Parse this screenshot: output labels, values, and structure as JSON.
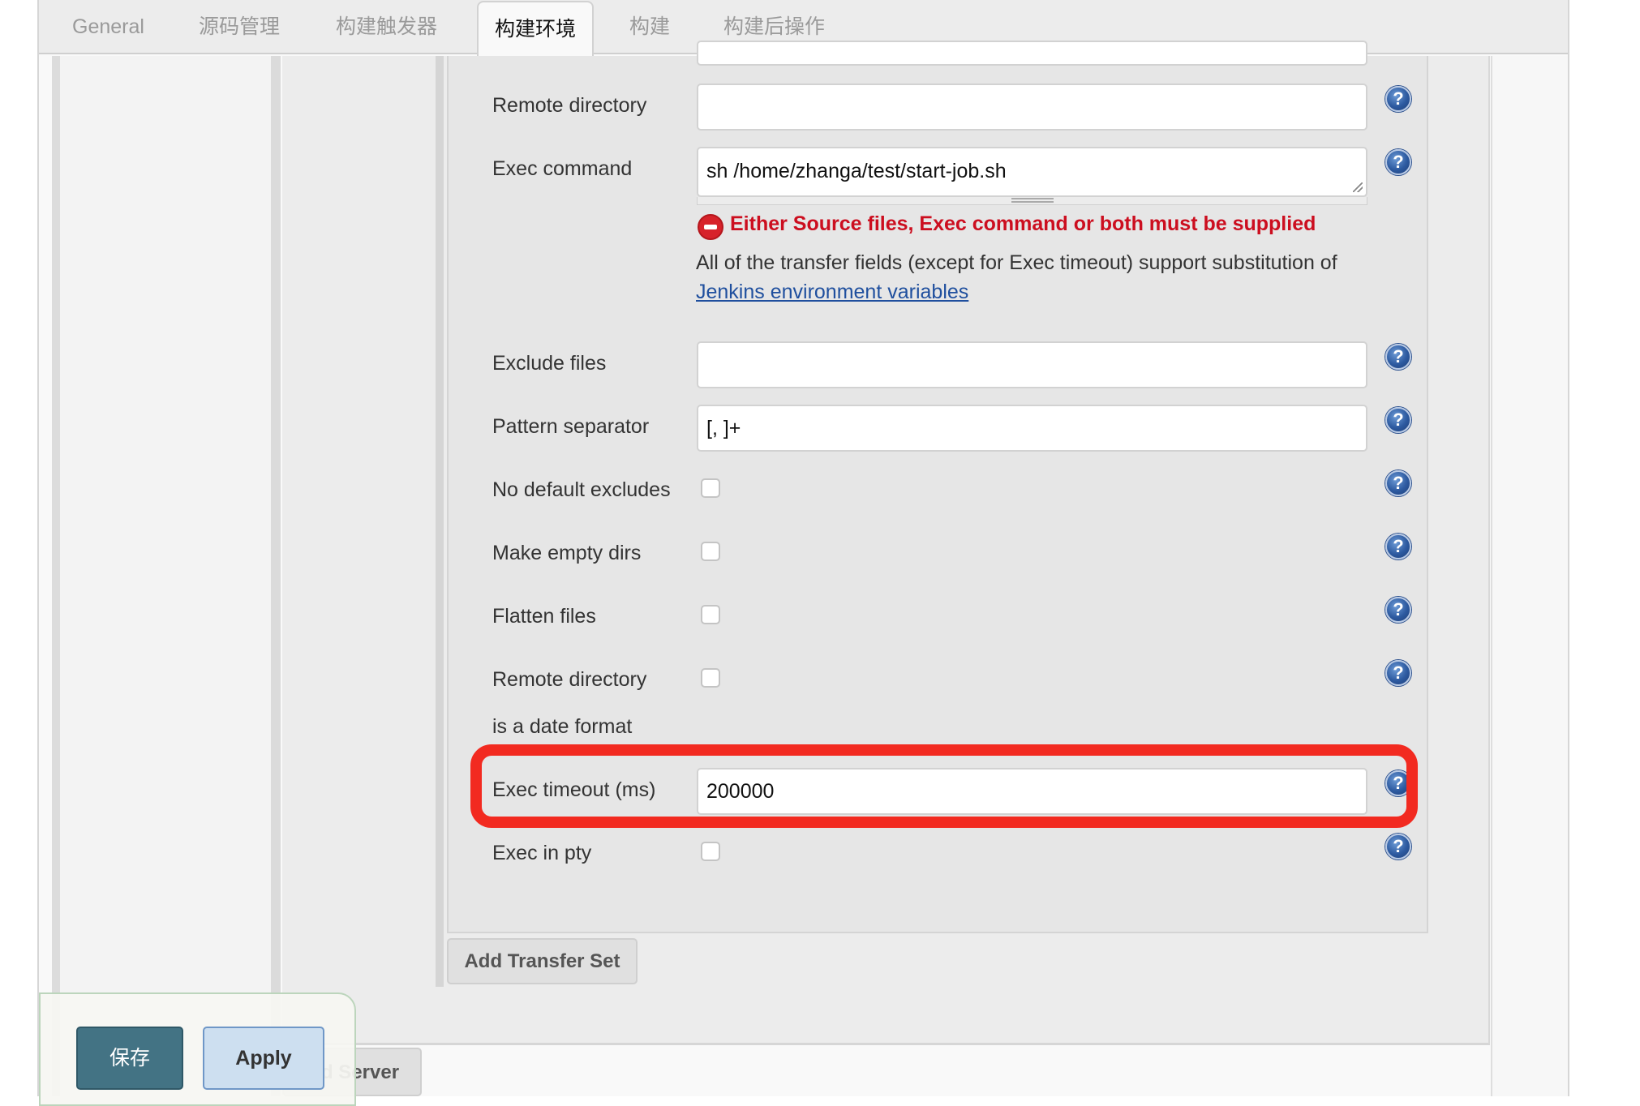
{
  "tabs": [
    {
      "label": "General",
      "active": false
    },
    {
      "label": "源码管理",
      "active": false
    },
    {
      "label": "构建触发器",
      "active": false
    },
    {
      "label": "构建环境",
      "active": true
    },
    {
      "label": "构建",
      "active": false
    },
    {
      "label": "构建后操作",
      "active": false
    }
  ],
  "form": {
    "remote_directory": {
      "label": "Remote directory",
      "value": ""
    },
    "exec_command": {
      "label": "Exec command",
      "value": "sh /home/zhanga/test/start-job.sh"
    },
    "error_message": "Either Source files, Exec command or both must be supplied",
    "info_text": "All of the transfer fields (except for Exec timeout) support substitution of",
    "env_link": "Jenkins environment variables",
    "exclude_files": {
      "label": "Exclude files",
      "value": ""
    },
    "pattern_separator": {
      "label": "Pattern separator",
      "value": "[, ]+"
    },
    "no_default_excludes": {
      "label": "No default excludes",
      "checked": false
    },
    "make_empty_dirs": {
      "label": "Make empty dirs",
      "checked": false
    },
    "flatten_files": {
      "label": "Flatten files",
      "checked": false
    },
    "remote_dir_date": {
      "label_line1": "Remote directory",
      "label_line2": "is a date format",
      "checked": false
    },
    "exec_timeout": {
      "label": "Exec timeout (ms)",
      "value": "200000"
    },
    "exec_in_pty": {
      "label": "Exec in pty",
      "checked": false
    }
  },
  "help_icon_glyph": "?",
  "buttons": {
    "add_transfer_set": "Add Transfer Set",
    "add_server": "Add Server",
    "add_server_visible": "d Server",
    "save": "保存",
    "apply": "Apply"
  },
  "colors": {
    "error": "#cc0e1f",
    "highlight": "#f22a20",
    "save_button": "#437384",
    "apply_button": "#cddff0",
    "link": "#1f4f9e"
  }
}
